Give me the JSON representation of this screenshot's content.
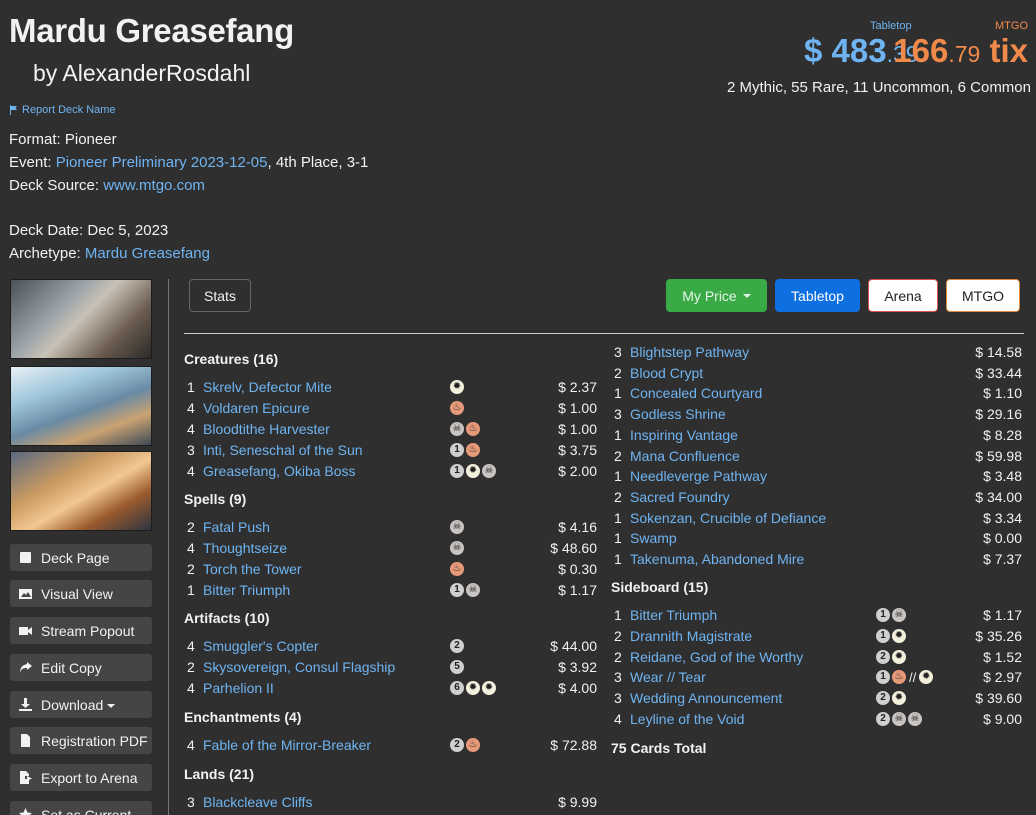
{
  "header": {
    "title": "Mardu Greasefang",
    "author": "by AlexanderRosdahl",
    "report_label": "Report Deck Name",
    "format_label": "Format:",
    "format_value": "Pioneer",
    "event_label": "Event:",
    "event_link": "Pioneer Preliminary 2023-12-05",
    "event_suffix": ", 4th Place, 3-1",
    "source_label": "Deck Source:",
    "source_link": "www.mtgo.com",
    "date_label": "Deck Date:",
    "date_value": "Dec 5, 2023",
    "archetype_label": "Archetype:",
    "archetype_link": "Mardu Greasefang"
  },
  "prices": {
    "tabletop_label": "Tabletop",
    "tabletop_main": "$ 483",
    "tabletop_cents": ".39",
    "mtgo_label": "MTGO",
    "mtgo_main": "166",
    "mtgo_cents": ".79",
    "mtgo_unit": " tix",
    "rarity": "2 Mythic, 55 Rare, 11 Uncommon, 6 Common"
  },
  "sidebar": {
    "buttons": [
      {
        "label": "Deck Page",
        "icon": "square-icon"
      },
      {
        "label": "Visual View",
        "icon": "image-icon"
      },
      {
        "label": "Stream Popout",
        "icon": "video-icon"
      },
      {
        "label": "Edit Copy",
        "icon": "share-arrow-icon"
      },
      {
        "label": "Download",
        "icon": "download-icon"
      },
      {
        "label": "Registration PDF",
        "icon": "file-pdf-icon"
      },
      {
        "label": "Export to Arena",
        "icon": "export-icon"
      },
      {
        "label": "Set as Current",
        "icon": "star-icon"
      }
    ]
  },
  "controls": {
    "stats": "Stats",
    "my_price": "My Price",
    "tabletop": "Tabletop",
    "arena": "Arena",
    "mtgo": "MTGO"
  },
  "colors": {
    "link": "#6fb4f2",
    "mtgo_orange": "#f08a4b",
    "my_price_green": "#3aaa47",
    "tabletop_blue": "#0e6fe0"
  },
  "deck": {
    "col1": [
      {
        "heading": "Creatures (16)",
        "cards": [
          {
            "qty": "1",
            "name": "Skrelv, Defector Mite",
            "mana": [
              "W"
            ],
            "price": "$ 2.37"
          },
          {
            "qty": "4",
            "name": "Voldaren Epicure",
            "mana": [
              "R"
            ],
            "price": "$ 1.00"
          },
          {
            "qty": "4",
            "name": "Bloodtithe Harvester",
            "mana": [
              "B",
              "R"
            ],
            "price": "$ 1.00"
          },
          {
            "qty": "3",
            "name": "Inti, Seneschal of the Sun",
            "mana": [
              "1",
              "R"
            ],
            "price": "$ 3.75"
          },
          {
            "qty": "4",
            "name": "Greasefang, Okiba Boss",
            "mana": [
              "1",
              "W",
              "B"
            ],
            "price": "$ 2.00"
          }
        ]
      },
      {
        "heading": "Spells (9)",
        "cards": [
          {
            "qty": "2",
            "name": "Fatal Push",
            "mana": [
              "B"
            ],
            "price": "$ 4.16"
          },
          {
            "qty": "4",
            "name": "Thoughtseize",
            "mana": [
              "B"
            ],
            "price": "$ 48.60"
          },
          {
            "qty": "2",
            "name": "Torch the Tower",
            "mana": [
              "R"
            ],
            "price": "$ 0.30"
          },
          {
            "qty": "1",
            "name": "Bitter Triumph",
            "mana": [
              "1",
              "B"
            ],
            "price": "$ 1.17"
          }
        ]
      },
      {
        "heading": "Artifacts (10)",
        "cards": [
          {
            "qty": "4",
            "name": "Smuggler's Copter",
            "mana": [
              "2"
            ],
            "price": "$ 44.00"
          },
          {
            "qty": "2",
            "name": "Skysovereign, Consul Flagship",
            "mana": [
              "5"
            ],
            "price": "$ 3.92"
          },
          {
            "qty": "4",
            "name": "Parhelion II",
            "mana": [
              "6",
              "W",
              "W"
            ],
            "price": "$ 4.00"
          }
        ]
      },
      {
        "heading": "Enchantments (4)",
        "cards": [
          {
            "qty": "4",
            "name": "Fable of the Mirror-Breaker",
            "mana": [
              "2",
              "R"
            ],
            "price": "$ 72.88"
          }
        ]
      },
      {
        "heading": "Lands (21)",
        "cards": [
          {
            "qty": "3",
            "name": "Blackcleave Cliffs",
            "mana": [],
            "price": "$ 9.99"
          }
        ]
      }
    ],
    "col2_lands": [
      {
        "qty": "3",
        "name": "Blightstep Pathway",
        "mana": [],
        "price": "$ 14.58"
      },
      {
        "qty": "2",
        "name": "Blood Crypt",
        "mana": [],
        "price": "$ 33.44"
      },
      {
        "qty": "1",
        "name": "Concealed Courtyard",
        "mana": [],
        "price": "$ 1.10"
      },
      {
        "qty": "3",
        "name": "Godless Shrine",
        "mana": [],
        "price": "$ 29.16"
      },
      {
        "qty": "1",
        "name": "Inspiring Vantage",
        "mana": [],
        "price": "$ 8.28"
      },
      {
        "qty": "2",
        "name": "Mana Confluence",
        "mana": [],
        "price": "$ 59.98"
      },
      {
        "qty": "1",
        "name": "Needleverge Pathway",
        "mana": [],
        "price": "$ 3.48"
      },
      {
        "qty": "2",
        "name": "Sacred Foundry",
        "mana": [],
        "price": "$ 34.00"
      },
      {
        "qty": "1",
        "name": "Sokenzan, Crucible of Defiance",
        "mana": [],
        "price": "$ 3.34"
      },
      {
        "qty": "1",
        "name": "Swamp",
        "mana": [],
        "price": "$ 0.00"
      },
      {
        "qty": "1",
        "name": "Takenuma, Abandoned Mire",
        "mana": [],
        "price": "$ 7.37"
      }
    ],
    "sideboard": {
      "heading": "Sideboard (15)",
      "cards": [
        {
          "qty": "1",
          "name": "Bitter Triumph",
          "mana": [
            "1",
            "B"
          ],
          "price": "$ 1.17"
        },
        {
          "qty": "2",
          "name": "Drannith Magistrate",
          "mana": [
            "1",
            "W"
          ],
          "price": "$ 35.26"
        },
        {
          "qty": "2",
          "name": "Reidane, God of the Worthy",
          "mana": [
            "2",
            "W"
          ],
          "price": "$ 1.52"
        },
        {
          "qty": "3",
          "name": "Wear // Tear",
          "mana": [
            "1",
            "R",
            "//",
            "W"
          ],
          "price": "$ 2.97"
        },
        {
          "qty": "3",
          "name": "Wedding Announcement",
          "mana": [
            "2",
            "W"
          ],
          "price": "$ 39.60"
        },
        {
          "qty": "4",
          "name": "Leyline of the Void",
          "mana": [
            "2",
            "B",
            "B"
          ],
          "price": "$ 9.00"
        }
      ]
    },
    "total": "75 Cards Total"
  }
}
